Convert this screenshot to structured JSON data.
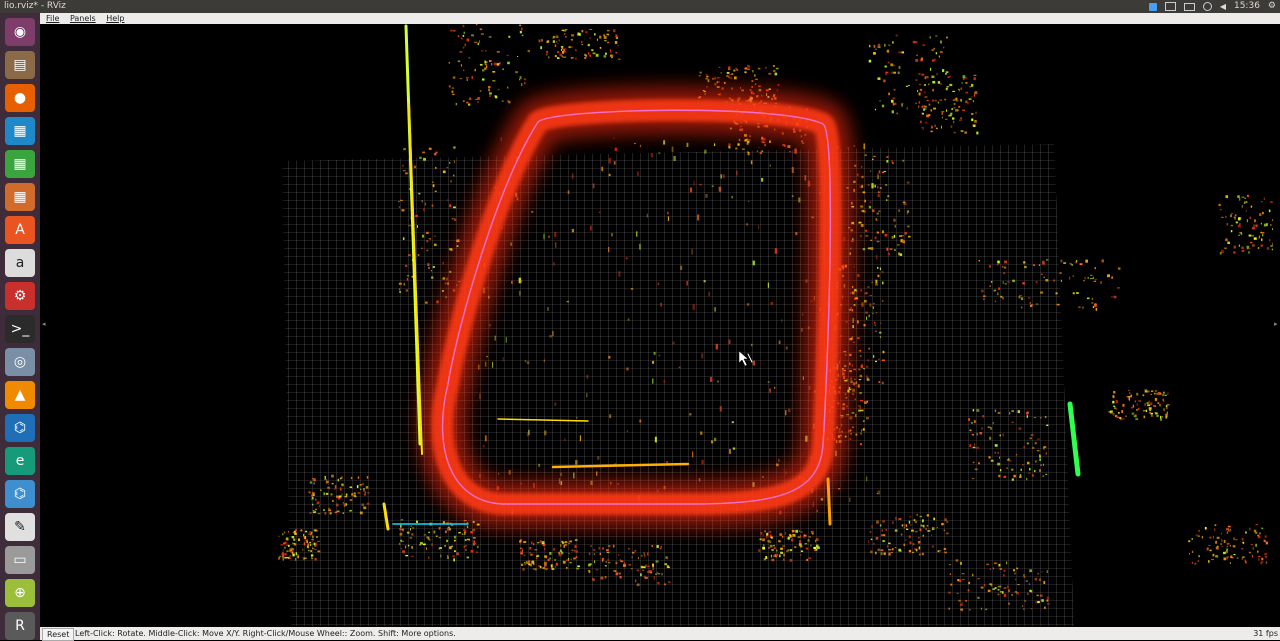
{
  "window": {
    "title": "lio.rviz* - RViz"
  },
  "tray": {
    "time": "15:36",
    "icons": [
      "dropbox-icon",
      "camera-icon",
      "keyboard-icon",
      "network-icon",
      "volume-icon",
      "power-icon"
    ]
  },
  "menu": {
    "file": "File",
    "panels": "Panels",
    "help": "Help"
  },
  "launcher": [
    {
      "name": "ubuntu-icon",
      "color": "#7e3d6a"
    },
    {
      "name": "files-icon",
      "color": "#8b6a48"
    },
    {
      "name": "firefox-icon",
      "color": "#e66000"
    },
    {
      "name": "writer-icon",
      "color": "#1e88c8"
    },
    {
      "name": "calc-icon",
      "color": "#3aa53f"
    },
    {
      "name": "impress-icon",
      "color": "#d16b2b"
    },
    {
      "name": "software-center-icon",
      "color": "#e95420"
    },
    {
      "name": "amazon-icon",
      "color": "#dcdcdc"
    },
    {
      "name": "settings-icon",
      "color": "#c9302c"
    },
    {
      "name": "terminal-icon",
      "color": "#2b2b2b"
    },
    {
      "name": "screenshot-icon",
      "color": "#7a8fa6"
    },
    {
      "name": "vlc-icon",
      "color": "#f08a00"
    },
    {
      "name": "vscode-icon",
      "color": "#1f6fb8"
    },
    {
      "name": "edge-dev-icon",
      "color": "#159b7a"
    },
    {
      "name": "vscode-alt-icon",
      "color": "#3e8fd0"
    },
    {
      "name": "text-editor-icon",
      "color": "#e0e0e0"
    },
    {
      "name": "drive-icon",
      "color": "#9a9a9a"
    },
    {
      "name": "image-viewer-icon",
      "color": "#9bbf3a"
    },
    {
      "name": "rviz-icon",
      "color": "#5a5a5a"
    }
  ],
  "status": {
    "reset_label": "Reset",
    "help_text": "Left-Click: Rotate. Middle-Click: Move X/Y. Right-Click/Mouse Wheel:: Zoom. Shift: More options.",
    "fps": "31 fps"
  },
  "colors": {
    "trajectory": "#ff2a10",
    "path": "#ff6fd0",
    "grid": "#a0a0a0",
    "points_green": "#44ff22",
    "points_yellow": "#ffd400"
  }
}
